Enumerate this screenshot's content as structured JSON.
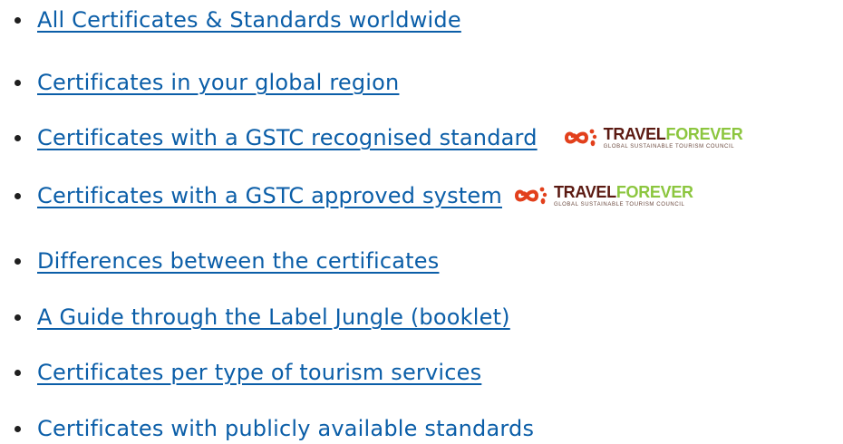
{
  "links": [
    {
      "label": "All Certificates & Standards worldwide"
    },
    {
      "label": "Certificates in your global region"
    },
    {
      "label": "Certificates with a GSTC recognised standard",
      "badge": {
        "brand_a": "TRAVEL",
        "brand_b": "FOREVER",
        "sub": "GLOBAL SUSTAINABLE TOURISM COUNCIL"
      }
    },
    {
      "label": "Certificates with a GSTC approved system",
      "badge": {
        "brand_a": "TRAVEL",
        "brand_b": "FOREVER",
        "sub": "GLOBAL SUSTAINABLE TOURISM COUNCIL"
      }
    },
    {
      "label": "Differences between the certificates"
    },
    {
      "label": "A Guide through the Label Jungle (booklet)"
    },
    {
      "label": "Certificates per type of tourism services"
    },
    {
      "label": "Certificates with publicly available standards"
    }
  ],
  "colors": {
    "link": "#0b5ea8",
    "bullet": "#1f1f1f",
    "logo_red": "#e2401c",
    "logo_dark": "#5b1a12",
    "logo_green": "#8cc63f"
  },
  "icons": {
    "badge_icon": "gstc-infinity-footprint-icon"
  }
}
